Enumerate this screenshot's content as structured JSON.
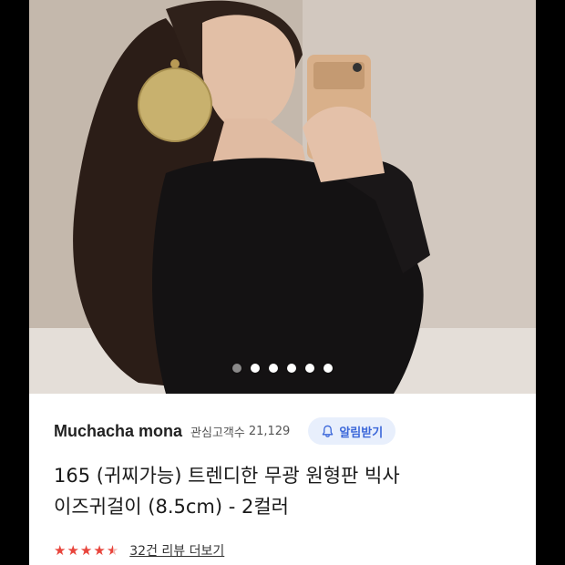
{
  "gallery": {
    "image_count": 6,
    "active_index": 0
  },
  "seller": {
    "name": "Muchacha mona",
    "followers_label": "관심고객수",
    "followers_count": "21,129",
    "notify_label": "알림받기",
    "notify_icon": "bell-icon"
  },
  "product": {
    "title_line1": "165 (귀찌가능) 트렌디한 무광 원형판 빅사",
    "title_line2": "이즈귀걸이 (8.5cm) - 2컬러"
  },
  "rating": {
    "stars": 4.5,
    "review_link": "32건 리뷰 더보기"
  },
  "colors": {
    "accent": "#3b67d9",
    "star": "#e8453c"
  }
}
